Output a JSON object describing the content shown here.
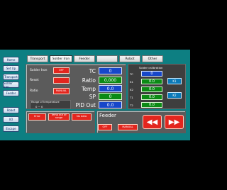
{
  "sidebar": {
    "items": [
      {
        "label": "Home"
      },
      {
        "label": "Set Up"
      },
      {
        "label": "Transport"
      },
      {
        "label": "Solder Iron"
      },
      {
        "label": "Feeder"
      },
      {
        "label": "Robot"
      },
      {
        "label": "I/O"
      },
      {
        "label": "Escape"
      }
    ]
  },
  "tabs": [
    {
      "label": "Transport"
    },
    {
      "label": "Solder Iron"
    },
    {
      "label": "Feeder"
    },
    {
      "label": ""
    },
    {
      "label": "Robot"
    },
    {
      "label": "Other"
    }
  ],
  "iron": {
    "solder_iron_label": "Solder Iron",
    "solder_iron_btn": "OFF",
    "reset_label": "Reset",
    "reset_btn": "",
    "ratio_label": "Ratio",
    "ratio_btn": "MANUAL",
    "range_title": "Range of temperature",
    "range_value": "0     ~   0"
  },
  "readings": {
    "tc_label": "TC",
    "tc_value": "0",
    "ratio_label": "Ratio",
    "ratio_value": "0.000",
    "temp_label": "Temp",
    "temp_value": "0.0",
    "sp_label": "SP",
    "sp_value": "0",
    "pid_label": "PID Out",
    "pid_value": "0.0"
  },
  "calibration": {
    "title": "Solder calibration",
    "tc_label": "TC",
    "tc_value": "0",
    "k1_label": "K1",
    "k1_value": "0.0",
    "k2_label": "K2",
    "k2_value": "0.0",
    "t1_label": "T1",
    "t1_value": "0.0",
    "t2_label": "T2",
    "t2_value": "0.0",
    "btn_k1": "K1",
    "btn_k2": "K2"
  },
  "bottom_buttons": {
    "error": "Error",
    "temp_out": "Temp out of range",
    "no_data": "No data"
  },
  "feeder": {
    "title": "Feeder",
    "off_btn": "OFF",
    "manual_btn": "MANUAL",
    "rev_icon": "◀◀",
    "fwd_icon": "▶▶"
  },
  "colors": {
    "screen_bg": "#0d7f82",
    "red": "#e3261e",
    "blue": "#1747c9",
    "green": "#0b8a15"
  }
}
